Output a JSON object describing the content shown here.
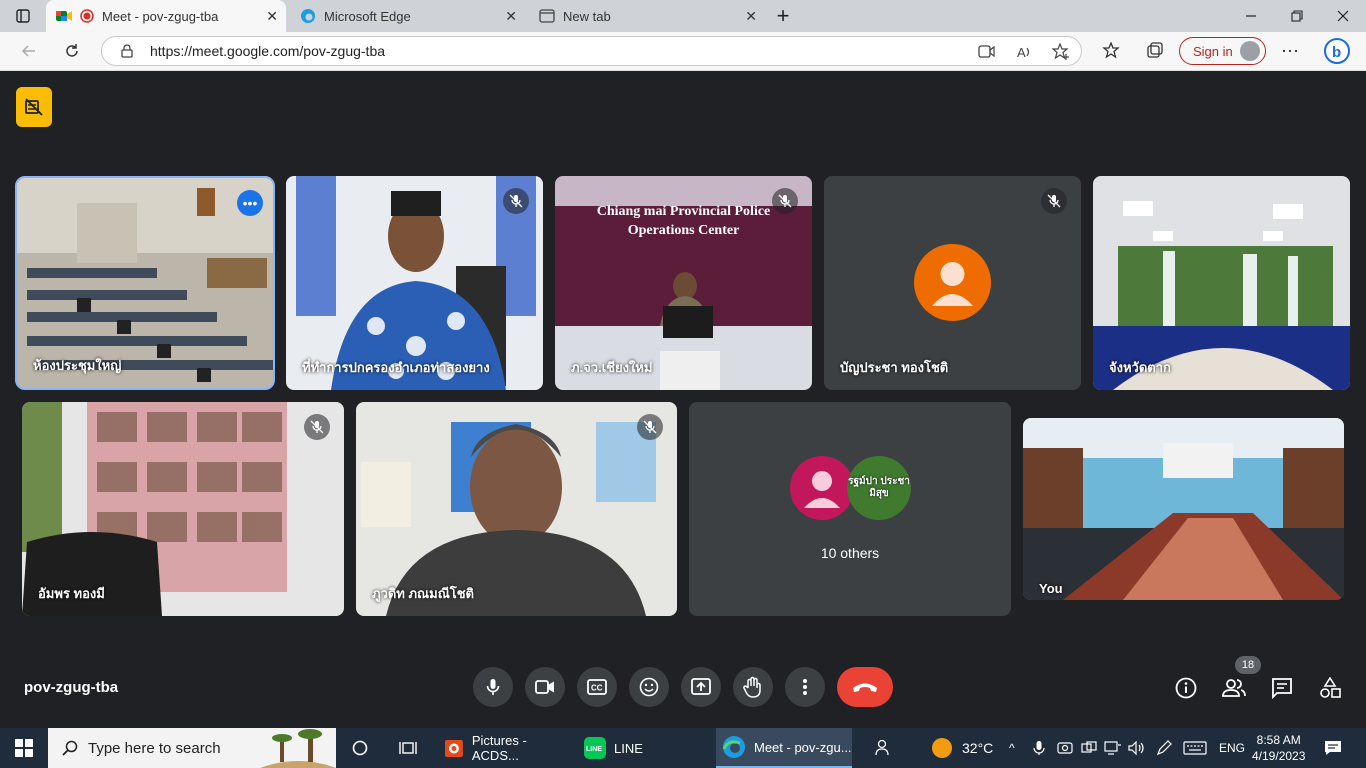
{
  "browser": {
    "tabs": [
      {
        "title": "Meet - pov-zgug-tba",
        "active": true
      },
      {
        "title": "Microsoft Edge",
        "active": false
      },
      {
        "title": "New tab",
        "active": false
      }
    ],
    "new_tab_symbol": "+",
    "url": "https://meet.google.com/pov-zgug-tba",
    "sign_in_label": "Sign in",
    "window_controls": [
      "minimize-icon",
      "restore-icon",
      "close-icon"
    ]
  },
  "meet": {
    "meeting_code": "pov-zgug-tba",
    "participant_count": "18",
    "tiles": [
      {
        "name": "ห้องประชุมใหญ่",
        "muted": false,
        "pinned": true
      },
      {
        "name": "ที่ทำการปกครองอำเภอท่าสองยาง",
        "muted": true
      },
      {
        "name": "ภ.จว.เชียงใหม่",
        "muted": true
      },
      {
        "name": "บัญประชา ทองโชติ",
        "muted": true,
        "avatar_color": "#ef6c00"
      },
      {
        "name": "จังหวัดตาก",
        "muted": false
      },
      {
        "name": "อัมพร ทองมี",
        "muted": true
      },
      {
        "name": "ภูวดิท ภณมณีโชติ",
        "muted": true
      },
      {
        "name": "10 others",
        "muted": false,
        "avatar_color": "#c2185b",
        "avatar2_label": "รฐม์ปา ประชามิสุข"
      },
      {
        "name": "You",
        "muted": false
      }
    ],
    "police_banner_line1": "Chiang mai Provincial Police",
    "police_banner_line2": "Operations Center",
    "controls": [
      "mic-icon",
      "camera-icon",
      "captions-icon",
      "emoji-icon",
      "present-icon",
      "raise-hand-icon",
      "more-options-icon",
      "leave-call-icon"
    ],
    "right_controls": [
      "info-icon",
      "people-icon",
      "chat-icon",
      "activities-icon"
    ],
    "colors": {
      "background": "#202124",
      "tile": "#3c4043",
      "pin_outline": "#8ab4f8",
      "leave": "#ea4335",
      "rec_badge": "#fbbc04"
    }
  },
  "taskbar": {
    "search_placeholder": "Type here to search",
    "apps": [
      {
        "label": "Pictures - ACDS...",
        "active": false
      },
      {
        "label": "LINE",
        "active": false
      },
      {
        "label": "Meet - pov-zgu...",
        "active": true
      }
    ],
    "weather": "32°C",
    "language": "ENG",
    "time": "8:58 AM",
    "date": "4/19/2023"
  }
}
